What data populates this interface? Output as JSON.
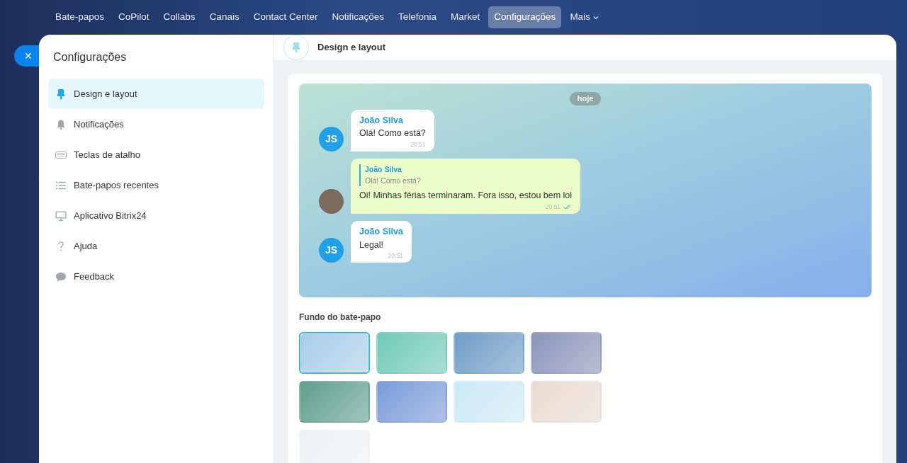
{
  "topnav": [
    {
      "label": "Bate-papos",
      "selected": false
    },
    {
      "label": "CoPilot",
      "selected": false
    },
    {
      "label": "Collabs",
      "selected": false
    },
    {
      "label": "Canais",
      "selected": false
    },
    {
      "label": "Contact Center",
      "selected": false
    },
    {
      "label": "Notificações",
      "selected": false
    },
    {
      "label": "Telefonia",
      "selected": false
    },
    {
      "label": "Market",
      "selected": false
    },
    {
      "label": "Configurações",
      "selected": true
    },
    {
      "label": "Mais",
      "selected": false,
      "kind": "dropdown"
    }
  ],
  "sidebar": {
    "title": "Configurações",
    "items": [
      {
        "label": "Design e layout",
        "selected": true
      },
      {
        "label": "Notificações",
        "selected": false
      },
      {
        "label": "Teclas de atalho",
        "selected": false
      },
      {
        "label": "Bate-papos recentes",
        "selected": false
      },
      {
        "label": "Aplicativo Bitrix24",
        "selected": false
      },
      {
        "label": "Ajuda",
        "selected": false
      },
      {
        "label": "Feedback",
        "selected": false
      }
    ]
  },
  "close_button": {
    "label": "✕"
  },
  "header": {
    "title": "Design e layout"
  },
  "preview": {
    "date": "hoje",
    "messages": [
      {
        "kind": "incoming",
        "avatar": "JS",
        "author": "João Silva",
        "text": "Olá! Como está?",
        "time": "20:51"
      },
      {
        "kind": "outgoing",
        "quote_author": "João Silva",
        "quote_text": "Olá! Como está?",
        "text": "Oi! Minhas férias terminaram. Fora isso, estou bem lol",
        "time": "20:51",
        "read": true
      },
      {
        "kind": "incoming",
        "avatar": "JS",
        "author": "João Silva",
        "text": "Legal!",
        "time": "20:51"
      }
    ]
  },
  "backgrounds": {
    "title": "Fundo do bate-papo",
    "items": [
      {
        "color": "#a9cde8",
        "selected": true
      },
      {
        "color": "#6fc9b8",
        "selected": false
      },
      {
        "color": "#6f9cc6",
        "selected": false
      },
      {
        "color": "#8a94b8",
        "selected": false
      },
      {
        "color": "#5f9f8c",
        "selected": false
      },
      {
        "color": "#7a9ad8",
        "selected": false
      },
      {
        "color": "#cbe9f5",
        "selected": false
      },
      {
        "color": "#eadbd0",
        "selected": false
      },
      {
        "color": "#eef1f3",
        "selected": false
      }
    ]
  }
}
